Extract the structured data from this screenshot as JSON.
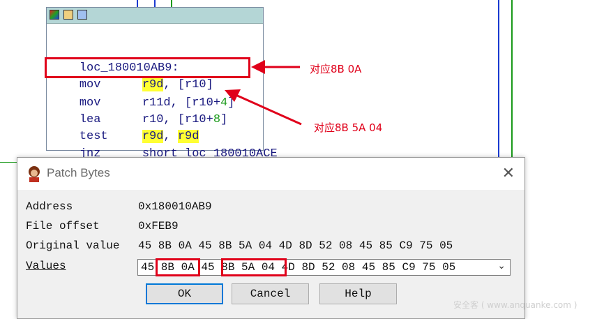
{
  "code_block": {
    "lines": [
      {
        "text": "loc_180010AB9:"
      },
      {
        "mnemonic": "mov",
        "operand_a": "r9d",
        "operand_b": ", [r10]"
      },
      {
        "mnemonic": "mov",
        "operand_a": "r11d, [r10+",
        "num": "4",
        "tail": "]"
      },
      {
        "mnemonic": "lea",
        "operand_a": "r10, [r10+",
        "num": "8",
        "tail": "]"
      },
      {
        "mnemonic": "test",
        "operand_a": "r9d",
        "operand_b": ", ",
        "operand_c": "r9d"
      },
      {
        "mnemonic": "jnz",
        "operand_a": "short loc_180010ACE"
      }
    ]
  },
  "annotations": {
    "first": "对应8B 0A",
    "second": "对应8B 5A 04"
  },
  "dialog": {
    "title": "Patch Bytes",
    "close_glyph": "✕",
    "address_label": "Address",
    "address_value": "0x180010AB9",
    "file_offset_label": "File offset",
    "file_offset_value": "0xFEB9",
    "original_label": "Original value",
    "original_value": "45 8B 0A 45 8B 5A 04 4D 8D 52 08 45 85 C9 75 05",
    "values_label": "Values",
    "values_value": "45 8B 0A 45 8B 5A 04 4D 8D 52 08 45 85 C9 75 05",
    "buttons": {
      "ok": "OK",
      "cancel": "Cancel",
      "help": "Help"
    }
  },
  "watermark": "安全客 ( www.anquanke.com )",
  "colors": {
    "accent_red": "#e0001a",
    "highlight": "#ffff33",
    "code_text": "#1a1a80",
    "focus_blue": "#0078d7"
  }
}
